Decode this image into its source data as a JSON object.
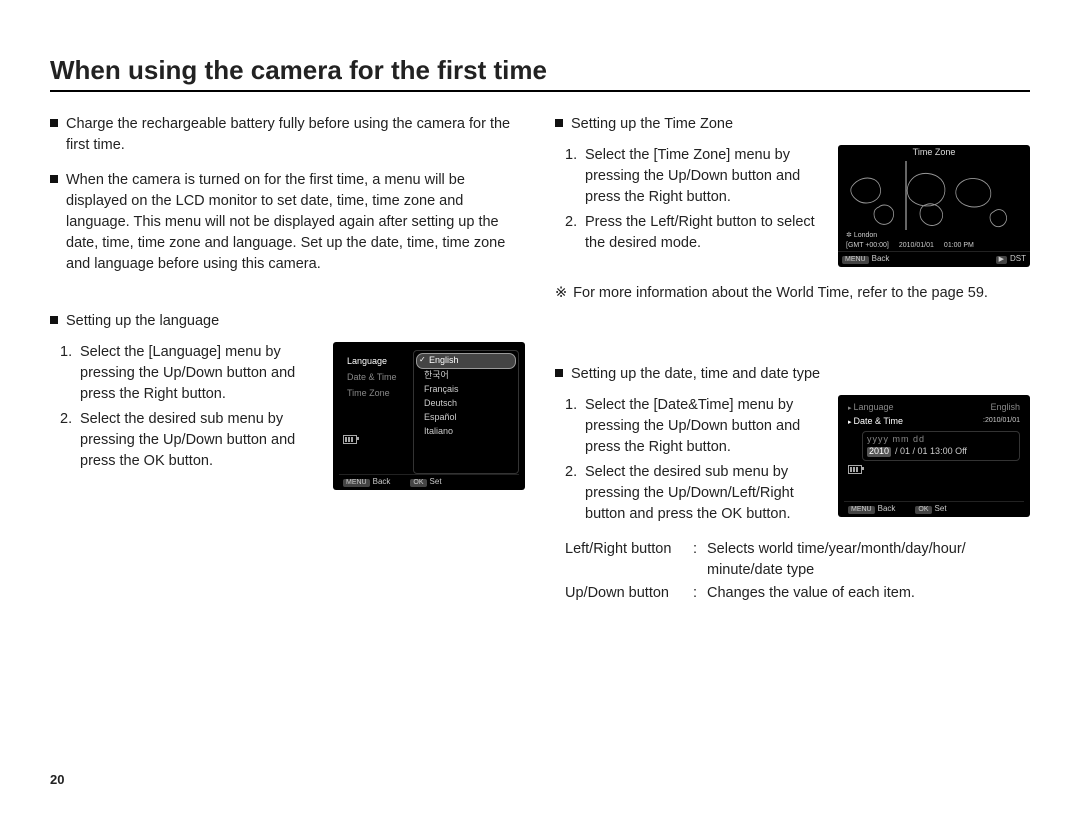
{
  "page_number": "20",
  "title": "When using the camera for the first time",
  "intro": [
    "Charge the rechargeable battery fully before using the camera for the first time.",
    "When the camera is turned on for the first time, a menu will be displayed on the LCD monitor to set date, time, time zone and language. This menu will not be displayed again after setting up the date, time, time zone and language. Set up the date, time, time zone and language before using this camera."
  ],
  "lang_section": {
    "heading": "Setting up the language",
    "steps": [
      "Select the [Language] menu by pressing the Up/Down button and press the Right button.",
      "Select the desired sub menu by pressing the Up/Down button and press the OK button."
    ]
  },
  "lcd_lang": {
    "left_items": [
      "Language",
      "Date & Time",
      "Time Zone"
    ],
    "options": [
      "English",
      "한국어",
      "Français",
      "Deutsch",
      "Español",
      "Italiano"
    ],
    "selected": "English",
    "foot_back_btn": "MENU",
    "foot_back": "Back",
    "foot_set_btn": "OK",
    "foot_set": "Set"
  },
  "tz_section": {
    "heading": "Setting up the Time Zone",
    "steps": [
      "Select the [Time Zone] menu by pressing the Up/Down button and press the Right button.",
      "Press the Left/Right button to select the desired mode."
    ]
  },
  "lcd_tz": {
    "title": "Time Zone",
    "city": "London",
    "gmt": "[GMT +00:00]",
    "date": "2010/01/01",
    "time": "01:00 PM",
    "foot_back_btn": "MENU",
    "foot_back": "Back",
    "foot_dst_btn": "▶",
    "foot_dst": "DST"
  },
  "tz_note_marker": "※",
  "tz_note": "For more information about the World Time, refer to the page 59.",
  "dt_section": {
    "heading": "Setting up the date, time and date type",
    "steps": [
      "Select the [Date&Time] menu by pressing the Up/Down button and press the Right button.",
      "Select the desired sub menu by pressing the Up/Down/Left/Right button and press the OK button."
    ]
  },
  "lcd_dt": {
    "row1_label": "Language",
    "row1_value": "English",
    "row2_label": "Date & Time",
    "row2_value": "2010/01/01",
    "format": "yyyy mm dd",
    "year": "2010",
    "rest": "/ 01 / 01   13:00   Off",
    "foot_back_btn": "MENU",
    "foot_back": "Back",
    "foot_set_btn": "OK",
    "foot_set": "Set"
  },
  "defs": {
    "lr_label": "Left/Right button",
    "lr_text": "Selects world time/year/month/day/hour/ minute/date type",
    "ud_label": "Up/Down button",
    "ud_text": "Changes the value of each item."
  }
}
